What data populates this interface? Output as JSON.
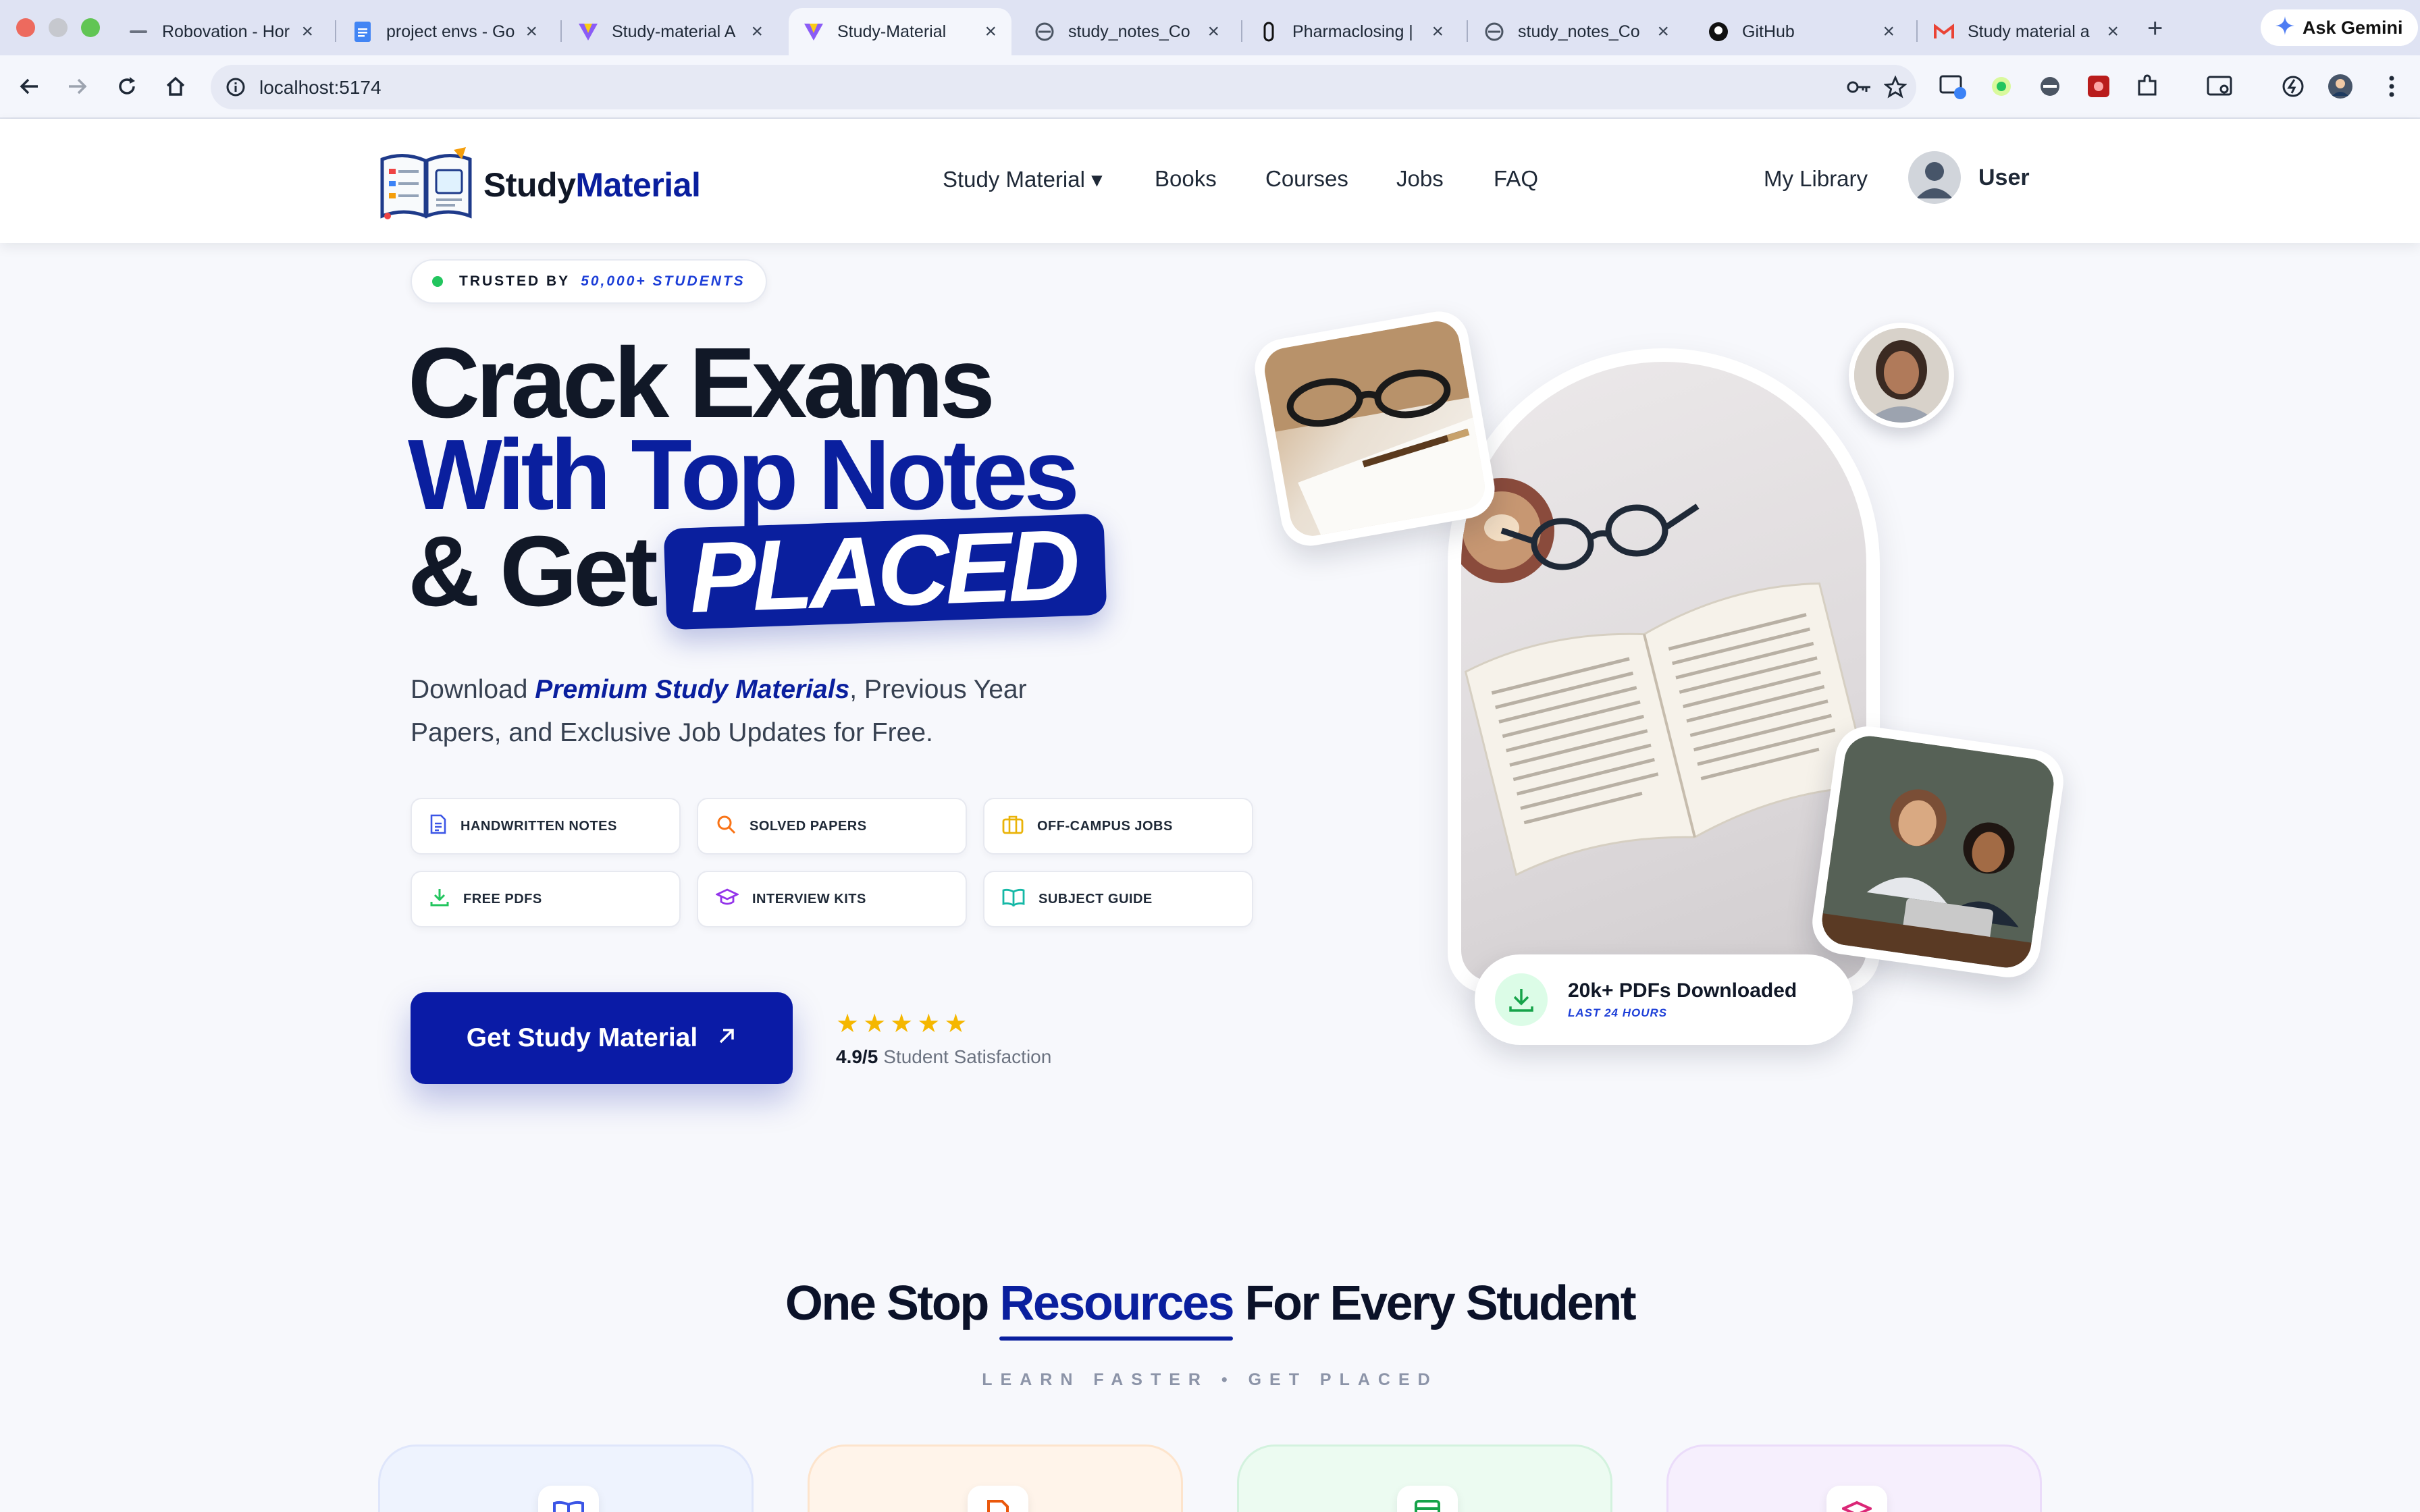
{
  "browser": {
    "tabs": [
      {
        "title": "Robovation - Hor",
        "icon": "robovation-favicon"
      },
      {
        "title": "project envs - Go",
        "icon": "google-docs-icon"
      },
      {
        "title": "Study-material A",
        "icon": "vite-icon"
      },
      {
        "title": "Study-Material",
        "icon": "vite-icon",
        "active": true
      },
      {
        "title": "study_notes_Co",
        "icon": "globe-icon"
      },
      {
        "title": "Pharmaclosing |",
        "icon": "pharmaclosing-favicon"
      },
      {
        "title": "study_notes_Co",
        "icon": "globe-icon"
      },
      {
        "title": "GitHub",
        "icon": "github-icon"
      },
      {
        "title": "Study material a",
        "icon": "gmail-icon"
      }
    ],
    "gemini_label": "Ask Gemini",
    "url": "localhost:5174"
  },
  "header": {
    "logo_text_1": "Study",
    "logo_text_2": "Material",
    "nav": {
      "study_material": "Study Material ▾",
      "books": "Books",
      "courses": "Courses",
      "jobs": "Jobs",
      "faq": "FAQ"
    },
    "my_library": "My Library",
    "user": "User"
  },
  "hero": {
    "trusted_prefix": "TRUSTED BY",
    "trusted_count": "50,000+ STUDENTS",
    "line1": "Crack Exams",
    "line2": "With Top Notes",
    "line3": "& Get",
    "badge": "PLACED",
    "sub_1": "Download ",
    "sub_em": "Premium Study Materials",
    "sub_2": ", Previous Year Papers, and Exclusive Job Updates for Free.",
    "chips": [
      {
        "label": "HANDWRITTEN NOTES",
        "icon": "document-icon",
        "color": "#3b55e6"
      },
      {
        "label": "SOLVED PAPERS",
        "icon": "search-icon",
        "color": "#f97316"
      },
      {
        "label": "OFF-CAMPUS JOBS",
        "icon": "briefcase-icon",
        "color": "#eab308"
      },
      {
        "label": "FREE PDFS",
        "icon": "download-icon",
        "color": "#22c55e"
      },
      {
        "label": "INTERVIEW KITS",
        "icon": "graduation-cap-icon",
        "color": "#9333ea"
      },
      {
        "label": "SUBJECT GUIDE",
        "icon": "open-book-icon",
        "color": "#14b8a6"
      }
    ],
    "cta": "Get Study Material",
    "rating_score": "4.9/5",
    "rating_label": "Student Satisfaction",
    "rating_stars": 5,
    "download_title": "20k+ PDFs Downloaded",
    "download_sub": "LAST 24 HOURS"
  },
  "resources": {
    "title_1": "One Stop ",
    "title_hl": "Resources",
    "title_2": " For Every Student",
    "subtitle": "LEARN FASTER • GET PLACED",
    "cards": [
      {
        "icon": "open-book-icon",
        "color": "#3b55e6",
        "bg": "#eef3fe",
        "border": "#dfe6fb"
      },
      {
        "icon": "document-icon",
        "color": "#ea580c",
        "bg": "#fff4ea",
        "border": "#fde4cc"
      },
      {
        "icon": "spreadsheet-icon",
        "color": "#16a34a",
        "bg": "#ecfbf1",
        "border": "#d3f2de"
      },
      {
        "icon": "graduation-cap-icon",
        "color": "#db2777",
        "bg": "#f6effd",
        "border": "#ebdcfa"
      }
    ]
  }
}
